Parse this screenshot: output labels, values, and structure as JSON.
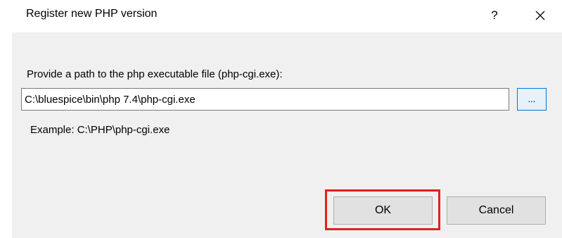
{
  "dialog": {
    "title": "Register new PHP version",
    "help_label": "?",
    "close_icon": "close-icon"
  },
  "form": {
    "prompt": "Provide a path to the php executable file (php-cgi.exe):",
    "path_value": "C:\\bluespice\\bin\\php 7.4\\php-cgi.exe",
    "browse_label": "...",
    "example": "Example: C:\\PHP\\php-cgi.exe"
  },
  "buttons": {
    "ok_label": "OK",
    "cancel_label": "Cancel"
  },
  "colors": {
    "highlight": "#e0211c",
    "body_background": "#f0f0f0",
    "browse_border": "#0078d7"
  }
}
